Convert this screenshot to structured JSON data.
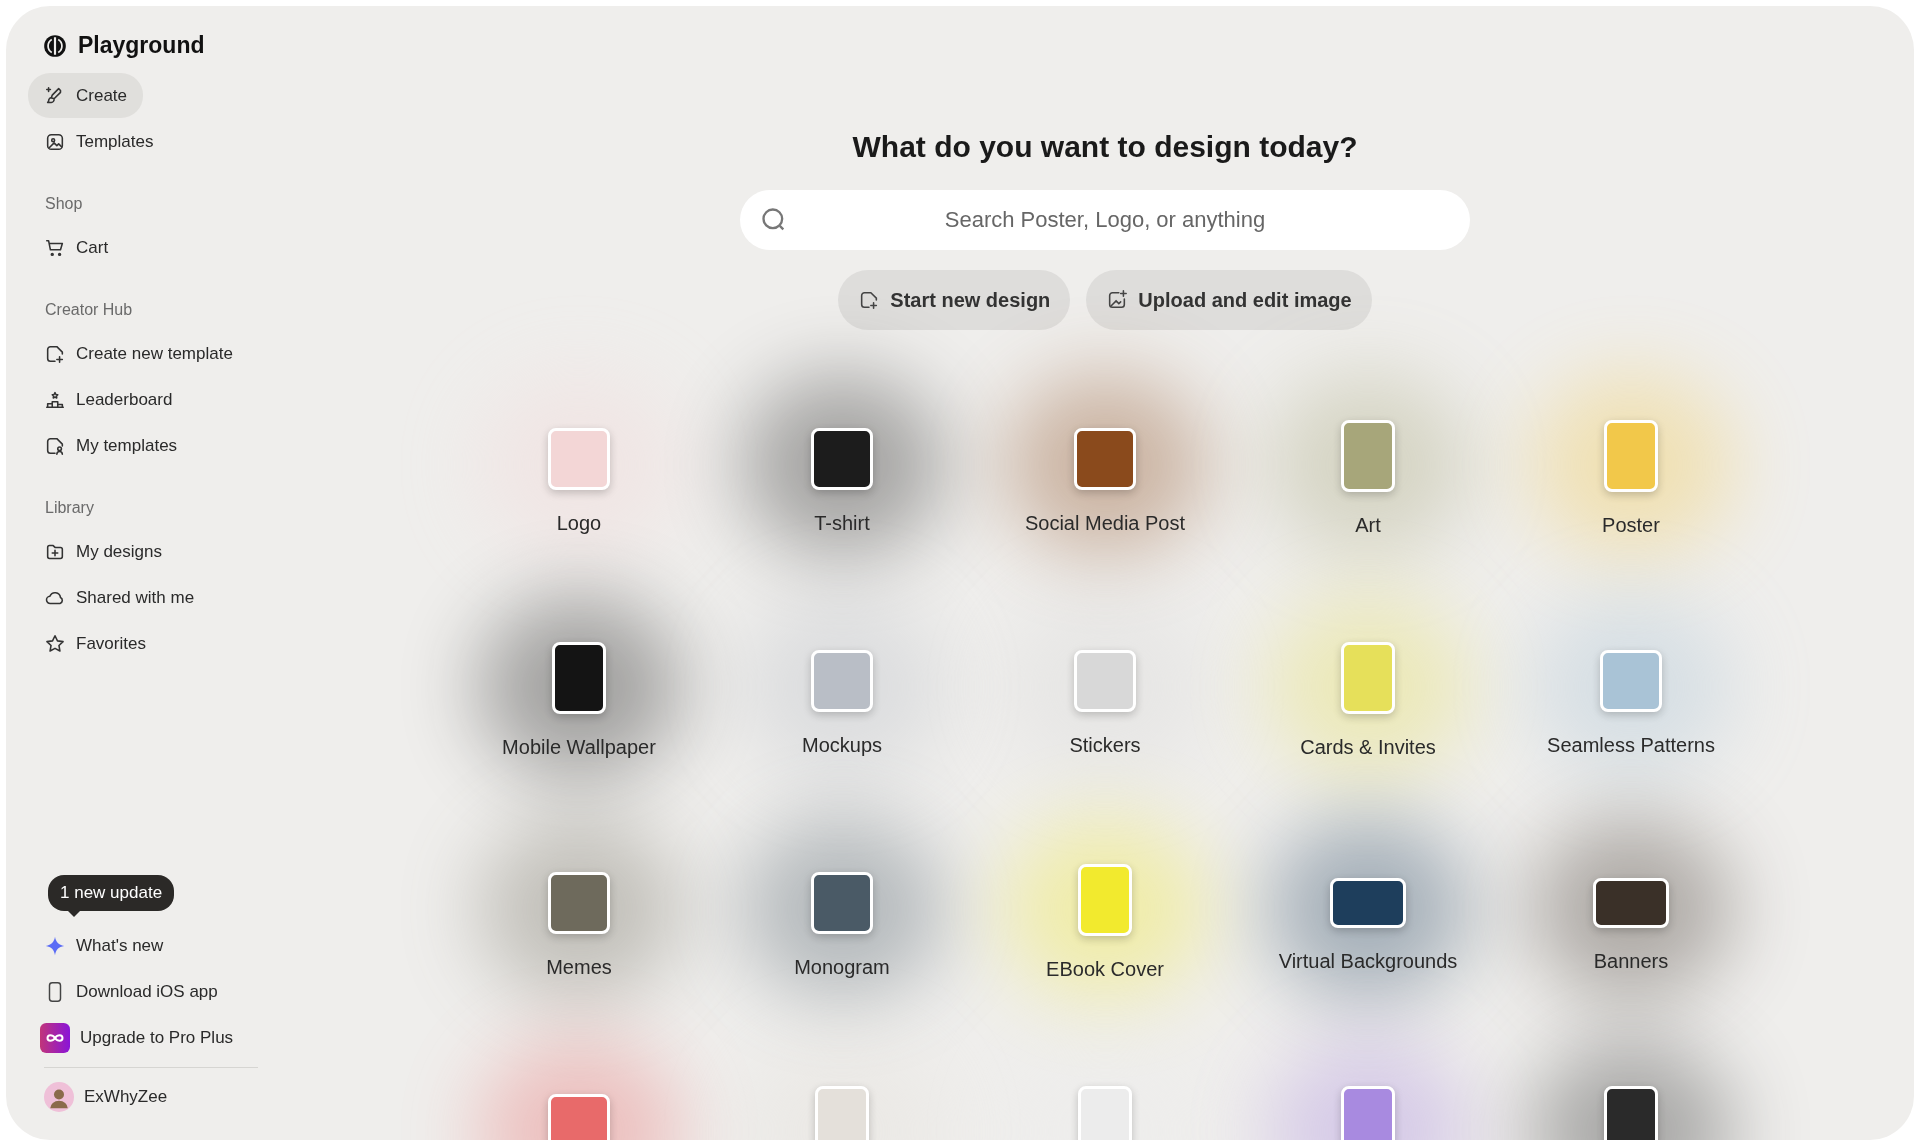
{
  "app": {
    "name": "Playground"
  },
  "sidebar": {
    "items": [
      {
        "label": "Create",
        "selected": true
      },
      {
        "label": "Templates",
        "selected": false
      }
    ],
    "sections": [
      {
        "heading": "Shop",
        "items": [
          {
            "label": "Cart",
            "selected": false
          }
        ]
      },
      {
        "heading": "Creator Hub",
        "items": [
          {
            "label": "Create new template",
            "selected": false
          },
          {
            "label": "Leaderboard",
            "selected": false
          },
          {
            "label": "My templates",
            "selected": false
          }
        ]
      },
      {
        "heading": "Library",
        "items": [
          {
            "label": "My designs",
            "selected": false
          },
          {
            "label": "Shared with me",
            "selected": false
          },
          {
            "label": "Favorites",
            "selected": false
          }
        ]
      }
    ],
    "update_tooltip": "1 new update",
    "footer_items": [
      {
        "label": "What's new"
      },
      {
        "label": "Download iOS app"
      },
      {
        "label": "Upgrade to Pro Plus"
      }
    ],
    "user": {
      "name": "ExWhyZee"
    }
  },
  "main": {
    "title": "What do you want to design today?",
    "search": {
      "placeholder": "Search Poster, Logo, or anything"
    },
    "actions": [
      {
        "label": "Start new design"
      },
      {
        "label": "Upload and edit image"
      }
    ],
    "categories": [
      {
        "label": "Logo",
        "kind": "square",
        "color": "#f3d6d6"
      },
      {
        "label": "T-shirt",
        "kind": "square",
        "color": "#1c1c1c"
      },
      {
        "label": "Social Media Post",
        "kind": "square",
        "color": "#8a4a1c"
      },
      {
        "label": "Art",
        "kind": "portrait",
        "color": "#a7a67a"
      },
      {
        "label": "Poster",
        "kind": "portrait",
        "color": "#f2c84a"
      },
      {
        "label": "Mobile Wallpaper",
        "kind": "portrait",
        "color": "#141414"
      },
      {
        "label": "Mockups",
        "kind": "square",
        "color": "#b9bec6"
      },
      {
        "label": "Stickers",
        "kind": "square",
        "color": "#d8d8d8"
      },
      {
        "label": "Cards & Invites",
        "kind": "portrait",
        "color": "#e6e05a"
      },
      {
        "label": "Seamless Patterns",
        "kind": "square",
        "color": "#a9c3d6"
      },
      {
        "label": "Memes",
        "kind": "square",
        "color": "#6e6a5c"
      },
      {
        "label": "Monogram",
        "kind": "square",
        "color": "#4a5a66"
      },
      {
        "label": "EBook Cover",
        "kind": "portrait",
        "color": "#f2ea2e"
      },
      {
        "label": "Virtual Backgrounds",
        "kind": "landscape",
        "color": "#1e3e5c"
      },
      {
        "label": "Banners",
        "kind": "landscape",
        "color": "#3a3028"
      },
      {
        "kind": "square",
        "color": "#e86a6a"
      },
      {
        "kind": "portrait",
        "color": "#e4e0da"
      },
      {
        "kind": "portrait",
        "color": "#ececec"
      },
      {
        "kind": "portrait",
        "color": "#a88ae0"
      },
      {
        "kind": "portrait",
        "color": "#2a2a2a"
      }
    ]
  }
}
